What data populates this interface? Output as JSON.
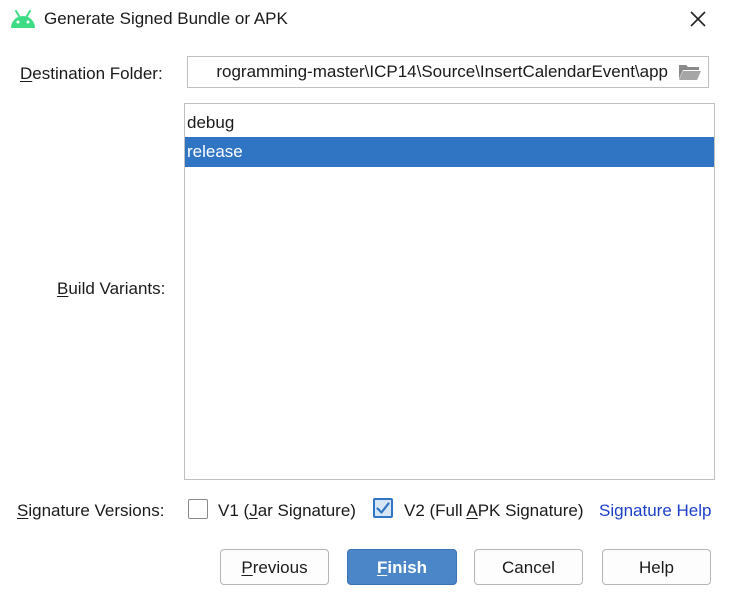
{
  "window": {
    "title": "Generate Signed Bundle or APK",
    "icons": {
      "app": "android-icon",
      "close": "close-icon"
    }
  },
  "destination": {
    "label": "Destination Folder:",
    "value": "rogramming-master\\ICP14\\Source\\InsertCalendarEvent\\app",
    "browse_icon": "folder-open-icon"
  },
  "build_variants": {
    "label": "Build Variants:",
    "items": [
      {
        "label": "debug",
        "selected": false
      },
      {
        "label": "release",
        "selected": true
      }
    ]
  },
  "signature": {
    "label": "Signature Versions:",
    "v1": {
      "label": "V1 (Jar Signature)",
      "checked": false
    },
    "v2": {
      "label": "V2 (Full APK Signature)",
      "checked": true
    },
    "help_link": "Signature Help"
  },
  "buttons": {
    "previous": "Previous",
    "finish": "Finish",
    "cancel": "Cancel",
    "help": "Help"
  },
  "colors": {
    "selection": "#2f75c3",
    "primary_button": "#4a86c8",
    "link": "#1d3fc8",
    "android_green": "#3ddc84"
  }
}
